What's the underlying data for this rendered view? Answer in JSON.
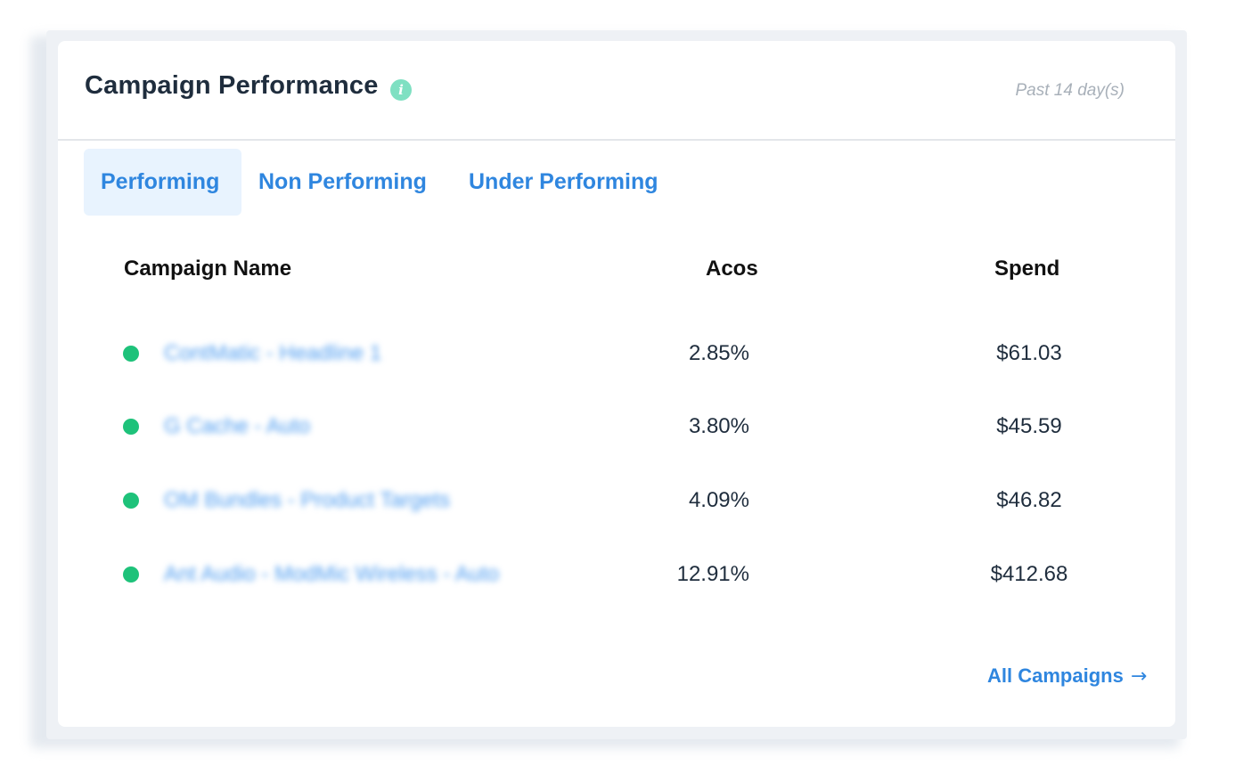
{
  "header": {
    "title": "Campaign Performance",
    "info_icon": "info-icon",
    "period": "Past 14 day(s)"
  },
  "tabs": [
    {
      "label": "Performing",
      "active": true
    },
    {
      "label": "Non Performing",
      "active": false
    },
    {
      "label": "Under Performing",
      "active": false
    }
  ],
  "table": {
    "columns": [
      "Campaign Name",
      "Acos",
      "Spend"
    ],
    "rows": [
      {
        "name": "ContMatic - Headline 1",
        "acos": "2.85%",
        "spend": "$61.03",
        "status_color": "#1ec27a"
      },
      {
        "name": "G Cache - Auto",
        "acos": "3.80%",
        "spend": "$45.59",
        "status_color": "#1ec27a"
      },
      {
        "name": "OM Bundles - Product Targets",
        "acos": "4.09%",
        "spend": "$46.82",
        "status_color": "#1ec27a"
      },
      {
        "name": "Ant Audio - ModMic Wireless - Auto",
        "acos": "12.91%",
        "spend": "$412.68",
        "status_color": "#1ec27a"
      }
    ]
  },
  "footer": {
    "link_label": "All Campaigns",
    "link_icon": "→"
  },
  "colors": {
    "accent": "#2f86df",
    "status_good": "#1ec27a",
    "info": "#7fe0c2"
  }
}
